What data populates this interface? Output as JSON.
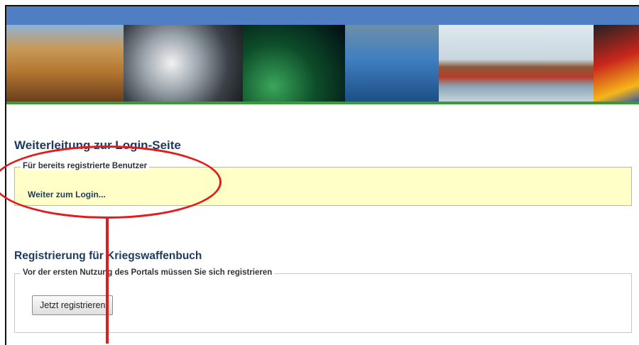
{
  "page": {
    "colors": {
      "header_bar": "#4f7fc2",
      "heading_text": "#1d3a5f",
      "login_box_bg": "#ffffc8",
      "accent_line": "#3a9a3a",
      "annotation_red": "#e21b1b"
    }
  },
  "banner": {
    "images": [
      "houses-solar-image",
      "steel-coils-image",
      "satellite-earth-image",
      "trade-fair-booth-image",
      "container-ship-image",
      "flags-image"
    ]
  },
  "login_section": {
    "title": "Weiterleitung zur Login-Seite",
    "legend": "Für bereits registrierte Benutzer",
    "link": "Weiter zum Login..."
  },
  "registration_section": {
    "title": "Registrierung für Kriegswaffenbuch",
    "legend": "Vor der ersten Nutzung des Portals müssen Sie sich registrieren",
    "button": "Jetzt registrieren"
  }
}
